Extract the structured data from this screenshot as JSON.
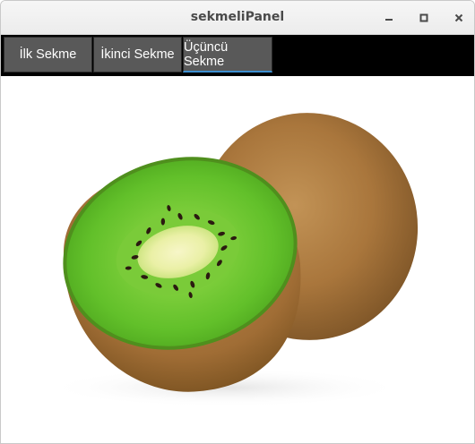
{
  "window": {
    "title": "sekmeliPanel",
    "controls": [
      "minimize-icon",
      "maximize-icon",
      "close-icon"
    ]
  },
  "tabs": [
    {
      "label": "İlk Sekme",
      "selected": false
    },
    {
      "label": "İkinci Sekme",
      "selected": false
    },
    {
      "label": "Üçüncü Sekme",
      "selected": true
    }
  ],
  "colors": {
    "tab_bar": "#000000",
    "tab_background": "#595959",
    "tab_selected_indicator": "#3d8fd1",
    "tab_text": "#ffffff"
  },
  "content": {
    "image": "kiwi-fruit"
  }
}
